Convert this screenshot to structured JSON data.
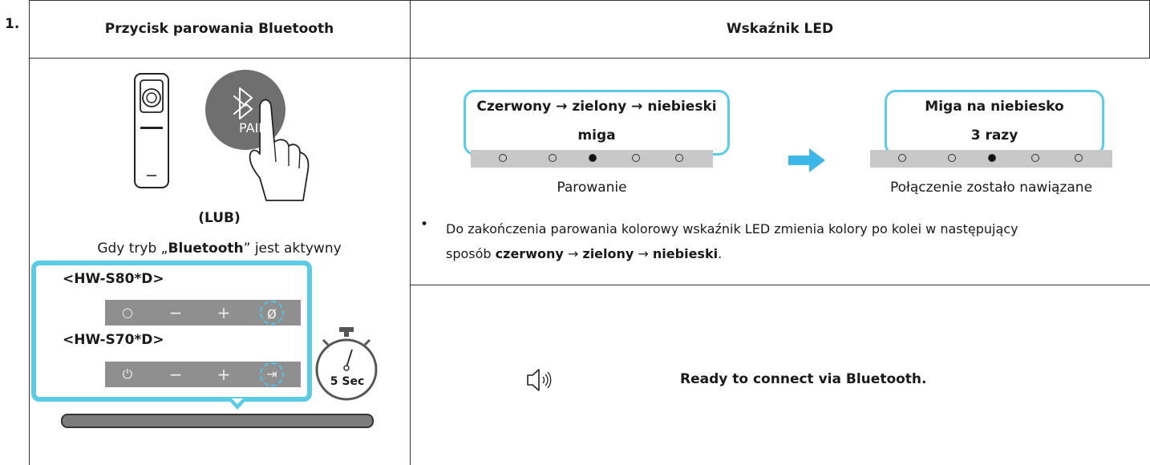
{
  "step": "1.",
  "headers": {
    "left": "Przycisk parowania Bluetooth",
    "right": "Wskaźnik LED"
  },
  "left": {
    "pair_label": "PAIR",
    "or_label": "(LUB)",
    "mode_text_before": "Gdy tryb „",
    "mode_text_bold": "Bluetooth",
    "mode_text_after": "” jest aktywny",
    "model_a": "<HW-S80*D>",
    "model_b": "<HW-S70*D>",
    "timer_label": "5 Sec"
  },
  "led": {
    "left_bubble_line1": "Czerwony → zielony → niebieski",
    "left_bubble_line2": "miga",
    "left_caption": "Parowanie",
    "right_bubble_line1": "Miga na niebiesko",
    "right_bubble_line2": "3 razy",
    "right_caption": "Połączenie zostało nawiązane",
    "note_part1": "Do zakończenia parowania kolorowy wskaźnik LED zmienia kolory po kolei w następujący",
    "note_part2": "sposób ",
    "note_c1": "czerwony",
    "note_arrow1": " → ",
    "note_c2": "zielony",
    "note_arrow2": " → ",
    "note_c3": "niebieski",
    "note_end": ".",
    "accent_color": "#5ccbe6"
  },
  "voice": {
    "icon": "speaker-icon",
    "message": "Ready to connect via Bluetooth."
  }
}
